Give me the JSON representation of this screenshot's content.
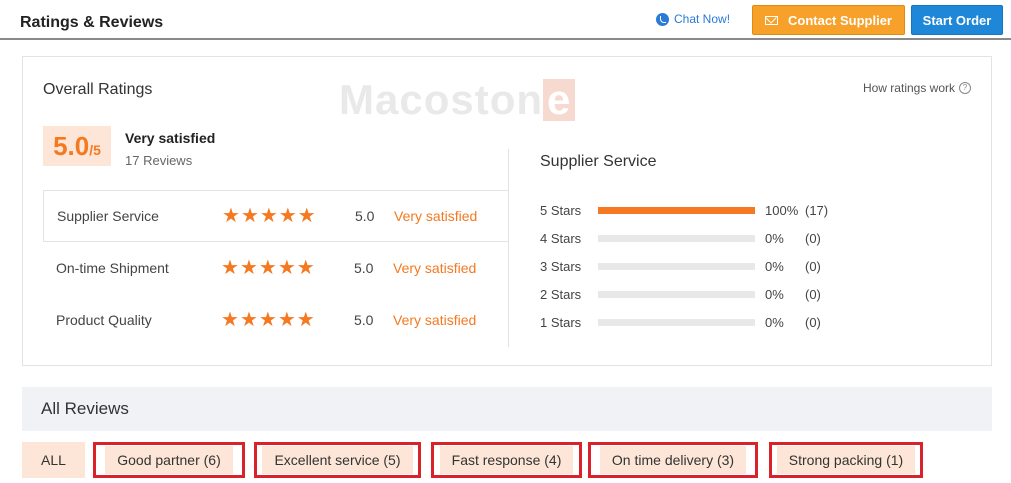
{
  "header": {
    "title": "Ratings & Reviews",
    "chat_label": "Chat Now!",
    "contact_label": "Contact Supplier",
    "start_label": "Start Order"
  },
  "overall": {
    "title": "Overall Ratings",
    "watermark_text": "Macoston",
    "watermark_e": "e",
    "how_ratings": "How ratings work",
    "score": "5.0",
    "score_max": "/5",
    "label": "Very satisfied",
    "reviews_count": "17 Reviews",
    "rows": [
      {
        "label": "Supplier Service",
        "rating": 5,
        "score": "5.0",
        "text": "Very satisfied"
      },
      {
        "label": "On-time Shipment",
        "rating": 5,
        "score": "5.0",
        "text": "Very satisfied"
      },
      {
        "label": "Product Quality",
        "rating": 5,
        "score": "5.0",
        "text": "Very satisfied"
      }
    ]
  },
  "distribution": {
    "title": "Supplier Service",
    "rows": [
      {
        "label": "5  Stars",
        "fraction": 1.0,
        "pct": "100%",
        "count": "(17)"
      },
      {
        "label": "4  Stars",
        "fraction": 0,
        "pct": "0%",
        "count": "(0)"
      },
      {
        "label": "3  Stars",
        "fraction": 0,
        "pct": "0%",
        "count": "(0)"
      },
      {
        "label": "2  Stars",
        "fraction": 0,
        "pct": "0%",
        "count": "(0)"
      },
      {
        "label": "1  Stars",
        "fraction": 0,
        "pct": "0%",
        "count": "(0)"
      }
    ]
  },
  "reviews": {
    "title": "All Reviews",
    "tags": [
      {
        "label": "ALL"
      },
      {
        "label": "Good partner (6)"
      },
      {
        "label": "Excellent service (5)"
      },
      {
        "label": "Fast response (4)"
      },
      {
        "label": "On time delivery (3)"
      },
      {
        "label": "Strong packing (1)"
      }
    ]
  },
  "colors": {
    "accent": "#f47920",
    "highlight_box": "#d9222a",
    "contact_button": "#f7a12a",
    "start_button": "#1e87d8"
  }
}
